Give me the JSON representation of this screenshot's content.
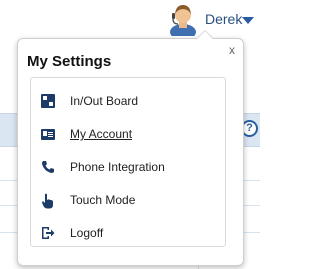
{
  "header": {
    "user_name": "Derek"
  },
  "popup": {
    "title": "My Settings",
    "close_label": "x",
    "items": [
      {
        "label": "In/Out Board",
        "icon": "inout-board-icon",
        "link": false
      },
      {
        "label": "My Account",
        "icon": "account-card-icon",
        "link": true
      },
      {
        "label": "Phone Integration",
        "icon": "phone-icon",
        "link": false
      },
      {
        "label": "Touch Mode",
        "icon": "touch-hand-icon",
        "link": false
      },
      {
        "label": "Logoff",
        "icon": "logoff-icon",
        "link": false
      }
    ]
  },
  "background": {
    "help_label": "?"
  },
  "colors": {
    "accent": "#2a5aa6",
    "icon_dark": "#1c3b66",
    "band": "#dbe6f3"
  }
}
